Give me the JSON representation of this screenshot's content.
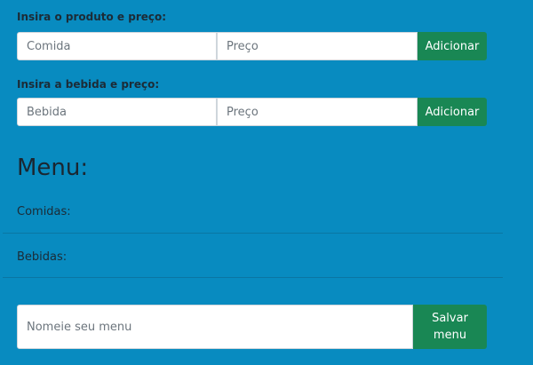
{
  "food_section": {
    "label": "Insira o produto e preço:",
    "name_placeholder": "Comida",
    "price_placeholder": "Preço",
    "add_label": "Adicionar"
  },
  "drink_section": {
    "label": "Insira a bebida e preço:",
    "name_placeholder": "Bebida",
    "price_placeholder": "Preço",
    "add_label": "Adicionar"
  },
  "menu": {
    "title": "Menu:",
    "foods_label": "Comidas:",
    "drinks_label": "Bebidas:"
  },
  "save_section": {
    "name_placeholder": "Nomeie seu menu",
    "save_label": "Salvar menu"
  },
  "colors": {
    "background": "#088bc0",
    "button": "#198754"
  }
}
